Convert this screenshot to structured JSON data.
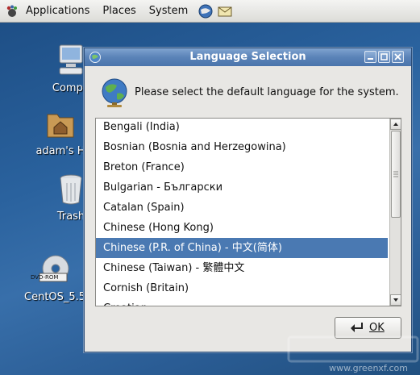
{
  "panel": {
    "menus": [
      "Applications",
      "Places",
      "System"
    ],
    "launchers": [
      "web-browser-launcher-icon",
      "mail-launcher-icon"
    ]
  },
  "desktop": {
    "icons": [
      {
        "label": "Compu",
        "icon": "computer-icon"
      },
      {
        "label": "adam's H",
        "icon": "home-folder-icon"
      },
      {
        "label": "Trash",
        "icon": "trash-icon"
      },
      {
        "label": "CentOS_5.5",
        "icon": "dvd-icon",
        "disc_text": "DVD-ROM"
      }
    ]
  },
  "dialog": {
    "title": "Language Selection",
    "prompt": "Please select the default language for the system.",
    "languages": [
      "Bengali (India)",
      "Bosnian (Bosnia and Herzegowina)",
      "Breton (France)",
      "Bulgarian - Български",
      "Catalan (Spain)",
      "Chinese (Hong Kong)",
      "Chinese (P.R. of China) - 中文(简体)",
      "Chinese (Taiwan) - 繁體中文",
      "Cornish (Britain)",
      "Croatian"
    ],
    "selected_language": "Chinese (P.R. of China) - 中文(简体)",
    "ok_label": "OK"
  },
  "watermark": {
    "text": "www.greenxf.com"
  },
  "colors": {
    "selection": "#4a79b2",
    "titlebar": "#5a83b8",
    "desktop": "#2a629e"
  }
}
